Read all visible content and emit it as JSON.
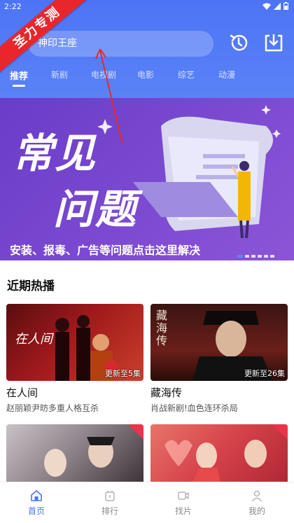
{
  "status": {
    "time": "2:22"
  },
  "ribbon": {
    "label": "圣力专测"
  },
  "search": {
    "placeholder": "神印王座"
  },
  "tabs": [
    {
      "label": "推荐",
      "active": true
    },
    {
      "label": "新剧"
    },
    {
      "label": "电视剧"
    },
    {
      "label": "电影"
    },
    {
      "label": "综艺"
    },
    {
      "label": "动漫"
    }
  ],
  "banner": {
    "title_line1": "常见",
    "title_line2": "问题",
    "caption": "安装、报毒、广告等问题点击这里解决",
    "pages": 6,
    "active_page": 1
  },
  "section": {
    "title": "近期热播"
  },
  "cards": [
    {
      "title": "在人间",
      "desc": "赵丽颖尹昉多重人格互杀",
      "badge": "更新至5集",
      "poster_text": "在人间"
    },
    {
      "title": "藏海传",
      "desc": "肖战新剧!血色连环杀局",
      "badge": "更新至26集",
      "poster_text": "藏海传"
    },
    {
      "title": "",
      "desc": "",
      "badge": "",
      "poster_text": ""
    },
    {
      "title": "",
      "desc": "",
      "badge": "",
      "poster_text": ""
    }
  ],
  "bottom_nav": [
    {
      "label": "首页",
      "icon": "home-icon",
      "active": true
    },
    {
      "label": "排行",
      "icon": "ranking-icon"
    },
    {
      "label": "找片",
      "icon": "video-icon"
    },
    {
      "label": "我的",
      "icon": "user-icon"
    }
  ],
  "colors": {
    "accent": "#4a76f5",
    "header": "#4d74f5",
    "banner": "#7a49d0",
    "ribbon": "#e8262c"
  }
}
